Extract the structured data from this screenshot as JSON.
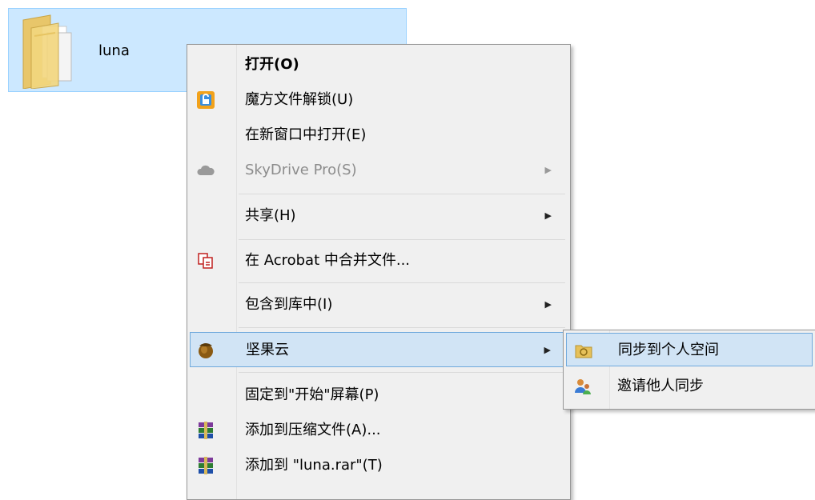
{
  "folder": {
    "name": "luna"
  },
  "context_menu": {
    "items": [
      {
        "label": "打开(O)",
        "icon": "none",
        "bold": true
      },
      {
        "label": "魔方文件解锁(U)",
        "icon": "unlock-icon"
      },
      {
        "label": "在新窗口中打开(E)",
        "icon": "none"
      },
      {
        "label": "SkyDrive Pro(S)",
        "icon": "cloud-icon",
        "disabled": true,
        "submenu": true
      },
      {
        "label": "共享(H)",
        "icon": "none",
        "submenu": true
      },
      {
        "label": "在 Acrobat 中合并文件...",
        "icon": "acrobat-icon"
      },
      {
        "label": "包含到库中(I)",
        "icon": "none",
        "submenu": true
      },
      {
        "label": "坚果云",
        "icon": "nut-icon",
        "submenu": true,
        "highlighted": true
      },
      {
        "label": "固定到\"开始\"屏幕(P)",
        "icon": "none"
      },
      {
        "label": "添加到压缩文件(A)...",
        "icon": "winrar-icon"
      },
      {
        "label": "添加到 \"luna.rar\"(T)",
        "icon": "winrar-icon"
      }
    ],
    "submenu_arrow": "▶"
  },
  "jianguoyun_submenu": {
    "items": [
      {
        "label": "同步到个人空间",
        "icon": "sync-folder-icon",
        "highlighted": true
      },
      {
        "label": "邀请他人同步",
        "icon": "invite-users-icon"
      }
    ]
  }
}
